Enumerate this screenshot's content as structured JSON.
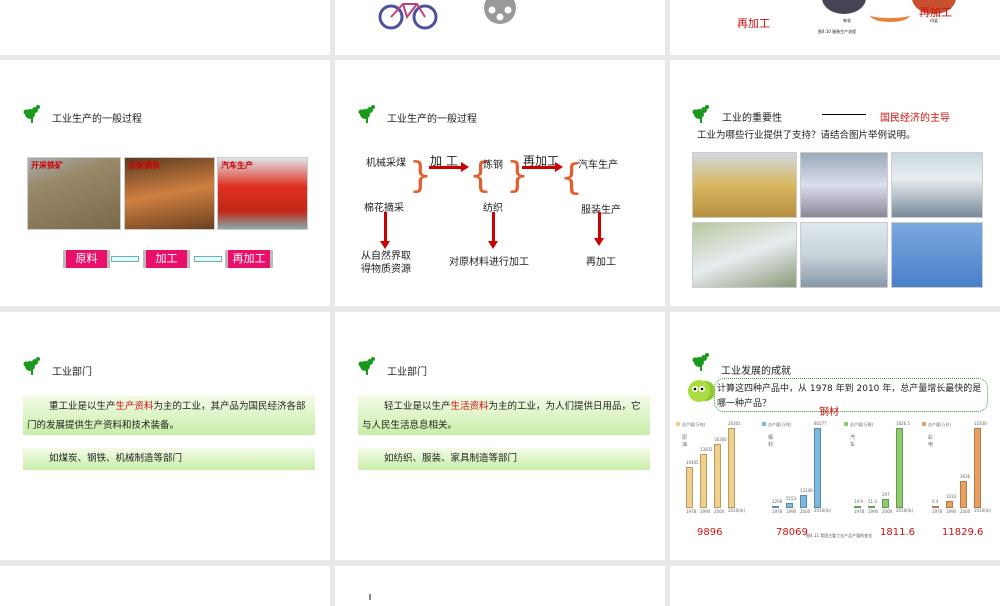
{
  "row1": {
    "slide3_labels": {
      "left": "再加工",
      "right": "再加工",
      "caption": "图4.10 服装生产流程",
      "l1": "制衣",
      "l2": "印染"
    }
  },
  "slide_process1": {
    "title": "工业生产的一般过程",
    "photos": [
      "开采铁矿",
      "冶炼钢铁",
      "汽车生产"
    ],
    "steps": [
      "原料",
      "加工",
      "再加工"
    ]
  },
  "slide_process2": {
    "title": "工业生产的一般过程",
    "col1": [
      "机械采煤",
      "棉花摘采"
    ],
    "arrow1": "加 工",
    "col2": [
      "炼钢",
      "纺织"
    ],
    "arrow2": "再加工",
    "col3": [
      "汽车生产",
      "服装生产"
    ],
    "bottom1a": "从自然界取",
    "bottom1b": "得物质资源",
    "bottom2": "对原材料进行加工",
    "bottom3": "再加工"
  },
  "slide_importance": {
    "title": "工业的重要性",
    "result": "国民经济的主导",
    "question": "工业为哪些行业提供了支持？请结合图片举例说明。"
  },
  "slide_heavy": {
    "title": "工业部门",
    "p1_pre": "重工业是以生产",
    "p1_hl": "生产资料",
    "p1_post": "为主的工业，其产品为国民经济各部门的发展提供生产资料和技术装备。",
    "p2": "如煤炭、钢铁、机械制造等部门"
  },
  "slide_light": {
    "title": "工业部门",
    "p1_pre": "轻工业是以生产",
    "p1_hl": "生活资料",
    "p1_post": "为主的工业，为人们提供日用品，它与人民生活息息相关。",
    "p2": "如纺织、服装、家具制造等部门"
  },
  "slide_achieve": {
    "title": "工业发展的成就",
    "question": "计算这四种产品中，从 1978 年到 2010 年，总产量增长最快的是哪一种产品？",
    "answer": "钢材",
    "caption": "图4.11 我国主要工业产品产量的变化",
    "diffs": [
      "9896",
      "78069",
      "1811.6",
      "11829.6"
    ]
  },
  "chart_data": [
    {
      "type": "bar",
      "title": "原油",
      "legend": "总产量(万吨)",
      "categories": [
        "1978",
        "1990",
        "2000",
        "2010(年)"
      ],
      "values": [
        10405,
        13831,
        16300,
        20301
      ],
      "color": "#f0d08a"
    },
    {
      "type": "bar",
      "title": "钢材",
      "legend": "总产量(万吨)",
      "categories": [
        "1978",
        "1990",
        "2000",
        "2010(年)"
      ],
      "values": [
        2208,
        5153,
        13146,
        80277
      ],
      "color": "#7ab8e0"
    },
    {
      "type": "bar",
      "title": "汽车",
      "legend": "总产量(万辆)",
      "categories": [
        "1978",
        "1990",
        "2000",
        "2010(年)"
      ],
      "values": [
        14.9,
        51.4,
        207.0,
        1826.5
      ],
      "color": "#8ccc6a"
    },
    {
      "type": "bar",
      "title": "彩电",
      "legend": "总产量(万台)",
      "categories": [
        "1978",
        "1990",
        "2000",
        "2010(年)"
      ],
      "values": [
        0.4,
        1033,
        3936,
        11830
      ],
      "color": "#e8a060"
    }
  ]
}
